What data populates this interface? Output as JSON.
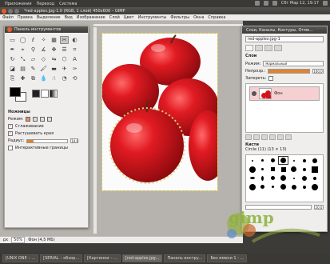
{
  "top_panel": {
    "menus": [
      "Приложения",
      "Переход",
      "Система"
    ],
    "clock": "Сбт Мар 12, 19:17"
  },
  "window": {
    "title": "*red-apples.jpg-1.0 (RGB, 1 слой) 450x600 – GIMP"
  },
  "main_menu": [
    "Файл",
    "Правка",
    "Выделение",
    "Вид",
    "Изображение",
    "Слой",
    "Цвет",
    "Инструменты",
    "Фильтры",
    "Окна",
    "Справка"
  ],
  "toolbox": {
    "title": "Панель инструментов",
    "options_header": "Ножницы",
    "mode_label": "Режим:",
    "antialias_label": "Сглаживание",
    "feather_label": "Растушевать края",
    "radius_label": "Радиус:",
    "radius_value": "10,0",
    "interactive_label": "Интерактивные границы",
    "feather_radius_fill": 0.15
  },
  "dock": {
    "title": "Слои, Каналы, Контуры, Отме...",
    "image_select": "red-apples.jpg-1",
    "layers_header": "Слои",
    "mode_label": "Режим:",
    "mode_value": "Нормальный",
    "opacity_label": "Непрозр.:",
    "opacity_value": "100,0",
    "lock_label": "Запереть:",
    "layer_name": "Фон",
    "brushes_header": "Кисти",
    "brush_info": "Circle (11) (13 × 13)",
    "brush_spacing_value": "20,0"
  },
  "status": {
    "unit": "px",
    "zoom": "50%",
    "info": "Фон (4,5 МБ)"
  },
  "taskbar": [
    "[UNIX ONE – ...",
    "[SERIAL – обзор...",
    "[Картинки – ...",
    "[red-apples.jpg...",
    "Панель инстру...",
    "Без имени 1 - ..."
  ],
  "watermark": "gimp"
}
